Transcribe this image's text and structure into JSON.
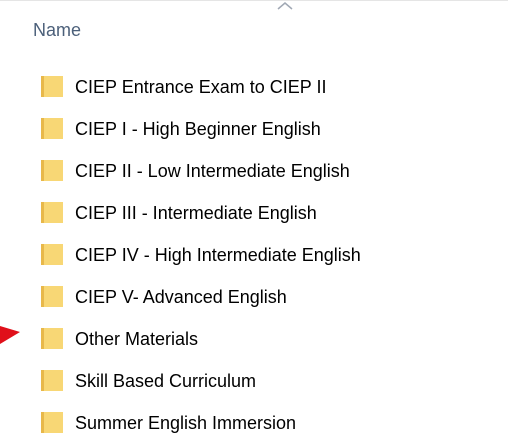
{
  "header": {
    "column_name": "Name"
  },
  "folders": [
    {
      "name": "CIEP Entrance Exam to CIEP II",
      "icon": "folder-icon"
    },
    {
      "name": "CIEP I - High Beginner English",
      "icon": "folder-icon"
    },
    {
      "name": "CIEP II - Low Intermediate English",
      "icon": "folder-icon"
    },
    {
      "name": "CIEP III - Intermediate English",
      "icon": "folder-icon"
    },
    {
      "name": "CIEP IV - High Intermediate English",
      "icon": "folder-icon"
    },
    {
      "name": "CIEP V- Advanced English",
      "icon": "folder-icon"
    },
    {
      "name": "Other Materials",
      "icon": "folder-icon"
    },
    {
      "name": "Skill Based Curriculum",
      "icon": "folder-icon"
    },
    {
      "name": "Summer English Immersion",
      "icon": "folder-icon"
    }
  ],
  "colors": {
    "folder_fill": "#f8d775",
    "folder_tab": "#e8b84a",
    "header_text": "#4c607a",
    "pointer_arrow": "#e0101a"
  }
}
